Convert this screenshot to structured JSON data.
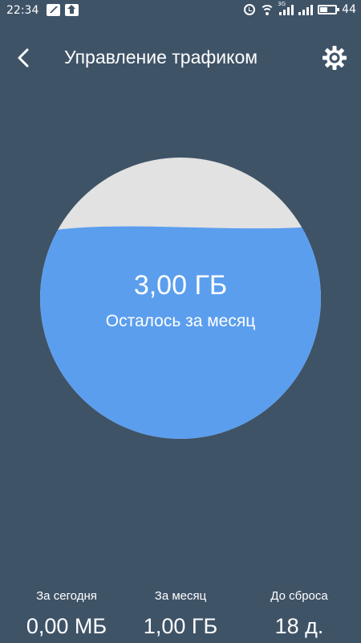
{
  "status_bar": {
    "time": "22:34",
    "network_label": "3G",
    "battery": "44"
  },
  "app_bar": {
    "title": "Управление трафиком",
    "back_icon": "back-arrow-icon",
    "settings_icon": "gear-icon"
  },
  "gauge": {
    "value": "3,00 ГБ",
    "caption": "Осталось за месяц",
    "fill_fraction": 0.75,
    "fill_color": "#5b9eee",
    "empty_color": "#e2e2e2"
  },
  "stats": [
    {
      "label": "За сегодня",
      "value": "0,00 МБ"
    },
    {
      "label": "За месяц",
      "value": "1,00 ГБ"
    },
    {
      "label": "До сброса",
      "value": "18 д."
    }
  ],
  "colors": {
    "background": "#3f5367",
    "text": "#ffffff"
  }
}
